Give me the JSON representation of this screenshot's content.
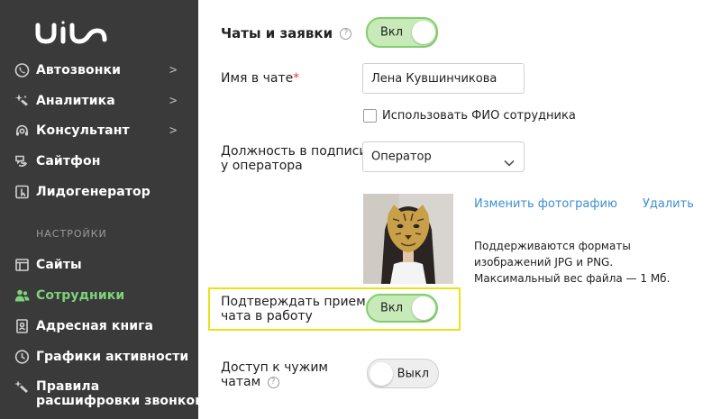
{
  "sidebar": {
    "logo_text": "uis",
    "items": [
      {
        "label": "Автозвонки",
        "icon": "phone-call-icon",
        "has_chevron": true
      },
      {
        "label": "Аналитика",
        "icon": "analytics-icon",
        "has_chevron": true
      },
      {
        "label": "Консультант",
        "icon": "consultant-icon",
        "has_chevron": true
      },
      {
        "label": "Сайтфон",
        "icon": "sitephone-icon",
        "has_chevron": false
      },
      {
        "label": "Лидогенератор",
        "icon": "lead-generator-icon",
        "has_chevron": false
      }
    ],
    "chevron_glyph": ">",
    "settings_header": "НАСТРОЙКИ",
    "settings_items": [
      {
        "label": "Сайты",
        "icon": "sites-icon",
        "active": false
      },
      {
        "label": "Сотрудники",
        "icon": "employees-icon",
        "active": true
      },
      {
        "label": "Адресная книга",
        "icon": "address-book-icon",
        "active": false
      },
      {
        "label": "Графики активности",
        "icon": "activity-schedule-icon",
        "active": false
      },
      {
        "label_line1": "Правила",
        "label_line2": "расшифровки звонков",
        "icon": "transcription-rules-icon",
        "active": false
      }
    ]
  },
  "main": {
    "chats_section": {
      "title": "Чаты и заявки",
      "help": "?",
      "toggle_label": "Вкл",
      "toggle_on": true
    },
    "chat_name": {
      "label": "Имя в чате",
      "required_mark": "*",
      "value": "Лена Кувшинчикова"
    },
    "use_full_name": {
      "label": "Использовать ФИО сотрудника",
      "checked": false
    },
    "position": {
      "label_line1": "Должность в подписи",
      "label_line2": "у оператора",
      "selected": "Оператор"
    },
    "photo": {
      "change_link": "Изменить фотографию",
      "delete_link": "Удалить",
      "note_line1": "Поддерживаются форматы",
      "note_line2": "изображений JPG и PNG.",
      "note_line3": "Максимальный вес файла — 1 Мб."
    },
    "confirm_chat": {
      "label_line1": "Подтверждать прием",
      "label_line2": "чата в работу",
      "toggle_label": "Вкл",
      "toggle_on": true
    },
    "access_foreign_chats": {
      "label_line1": "Доступ к чужим",
      "label_line2": "чатам",
      "help": "?",
      "toggle_label": "Выкл",
      "toggle_on": false
    }
  },
  "colors": {
    "sidebar_bg": "#3a3a3a",
    "active_green": "#7fd17a",
    "toggle_on_bg": "#c8eab9",
    "toggle_on_border": "#7fcf6b",
    "link_blue": "#3d8ed0",
    "highlight_yellow": "#e8e218",
    "required_red": "#e23b3b"
  }
}
